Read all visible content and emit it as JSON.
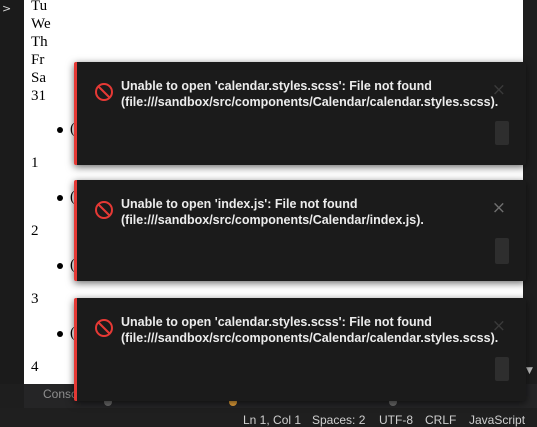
{
  "gutter": {
    "chevron": ">"
  },
  "preview": {
    "weekdays": [
      "Tu",
      "We",
      "Th",
      "Fr",
      "Sa"
    ],
    "first_number": "31",
    "dates": [
      "1",
      "2",
      "3",
      "4"
    ],
    "bullet_text": "("
  },
  "console": {
    "tab_label": "Consc"
  },
  "statusbar": {
    "position": "Ln 1, Col 1",
    "spaces": "Spaces: 2",
    "encoding": "UTF-8",
    "eol": "CRLF",
    "language": "JavaScript"
  },
  "notifications": [
    {
      "line1": "Unable to open 'calendar.styles.scss': File not found",
      "line2": "(file:///sandbox/src/components/Calendar/calendar.styles.scss).",
      "close": "×"
    },
    {
      "line1": "Unable to open 'index.js': File not found",
      "line2": "(file:///sandbox/src/components/Calendar/index.js).",
      "close": "×"
    },
    {
      "line1": "Unable to open 'calendar.styles.scss': File not found",
      "line2": "(file:///sandbox/src/components/Calendar/calendar.styles.scss).",
      "close": "×"
    }
  ],
  "colors": {
    "error_accent": "#e53935",
    "toast_bg": "#1b1b1b"
  }
}
